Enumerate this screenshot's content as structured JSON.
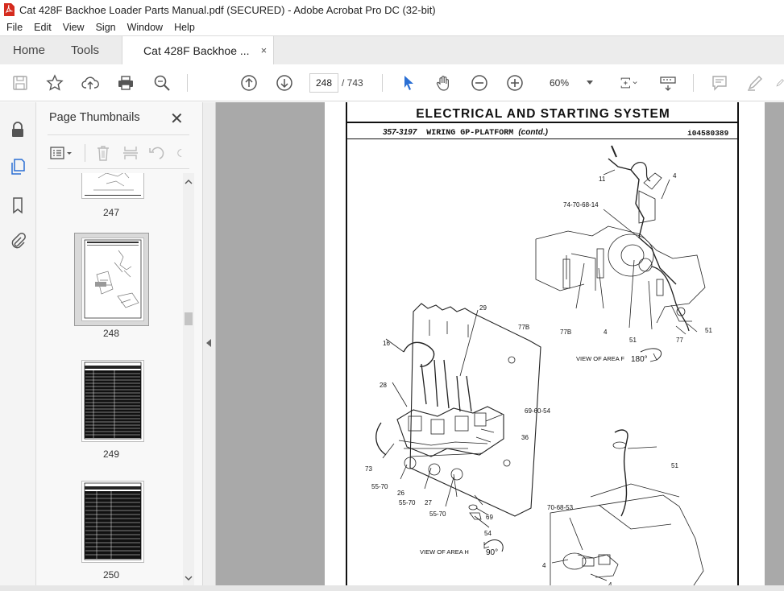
{
  "window": {
    "title": "Cat 428F Backhoe Loader Parts Manual.pdf (SECURED) - Adobe Acrobat Pro DC (32-bit)"
  },
  "menu": [
    "File",
    "Edit",
    "View",
    "Sign",
    "Window",
    "Help"
  ],
  "tabs": {
    "home": "Home",
    "tools": "Tools",
    "document": "Cat 428F Backhoe ...",
    "close": "×"
  },
  "toolbar": {
    "current_page": "248",
    "page_of": "/  743",
    "zoom": "60%"
  },
  "thumbnails_panel": {
    "title": "Page Thumbnails",
    "close": "✕",
    "pages": [
      "247",
      "248",
      "249",
      "250"
    ],
    "selected_page": "248"
  },
  "document": {
    "heading": "ELECTRICAL AND STARTING SYSTEM",
    "part_no": "357-3197",
    "section": "WIRING GP-PLATFORM",
    "contd": "(contd.)",
    "illustration_id": "i04580389",
    "callouts": {
      "c11": "11",
      "c4a": "4",
      "c74": "74-70-68-14",
      "c77b1": "77B",
      "c77b2": "77B",
      "c4b": "4",
      "c51a": "51",
      "c77": "77",
      "c51b": "51",
      "viewF": "VIEW OF AREA  F",
      "rotF": "180°",
      "c29": "29",
      "c16": "16",
      "c28": "28",
      "c6960": "69-60-54",
      "c36": "36",
      "c73": "73",
      "c5570a": "55-70",
      "c26": "26",
      "c5570b": "55-70",
      "c27": "27",
      "c5570c": "55-70",
      "c69": "69",
      "c54": "54",
      "viewH": "VIEW OF AREA  H",
      "rotH": "90°",
      "c51c": "51",
      "c7068": "70-68-53",
      "c4c": "4",
      "c4d": "4"
    }
  },
  "colors": {
    "accent_blue": "#2b6fd4",
    "acrobat_red": "#d52b1e",
    "doc_bg": "#a9a9a9"
  }
}
